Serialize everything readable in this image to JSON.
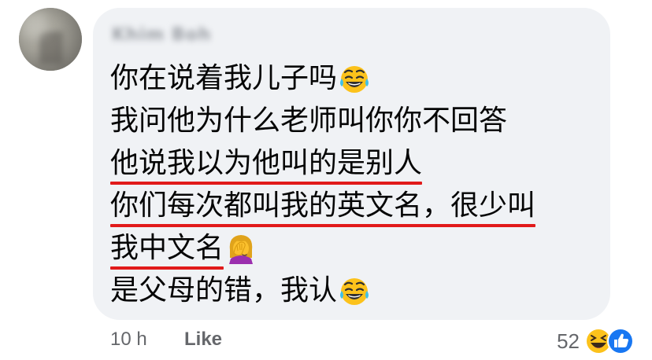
{
  "comment": {
    "author_name": "Khim Boh",
    "lines": [
      "你在说着我儿子吗",
      "我问他为什么老师叫你你不回答",
      "他说我以为他叫的是别人",
      "你们每次都叫我的英文名，很少叫",
      "我中文名",
      "是父母的错，我认"
    ],
    "emojis": [
      "laughing-tears-emoji",
      "woman-facepalming-emoji",
      "laughing-tears-emoji"
    ]
  },
  "footer": {
    "time": "10 h",
    "like_label": "Like",
    "reaction_count": "52",
    "reaction_icons": [
      "haha-reaction-icon",
      "like-reaction-icon"
    ]
  },
  "colors": {
    "bubble": "#f0f2f5",
    "text": "#050505",
    "meta_text": "#65676b",
    "underline": "#e11a1a",
    "like_blue": "#1877f2"
  }
}
